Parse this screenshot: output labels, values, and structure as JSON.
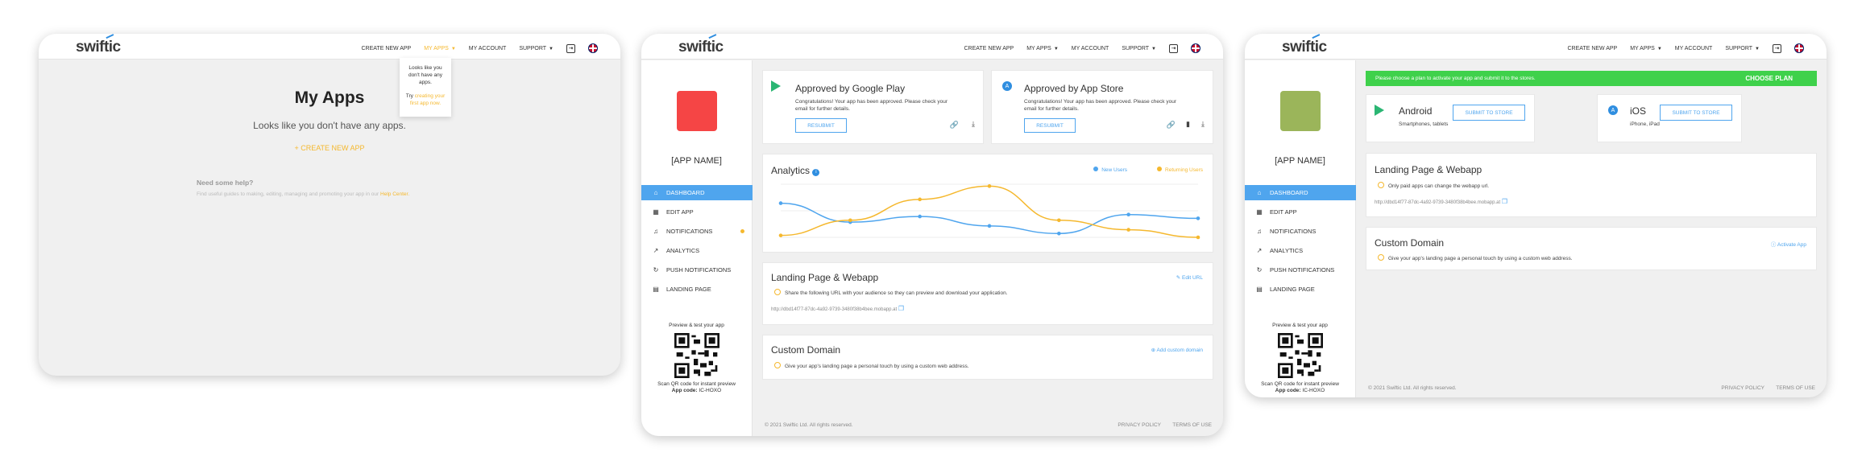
{
  "logo": "swiftic",
  "nav": {
    "create": "CREATE NEW APP",
    "myapps": "MY APPS",
    "account": "MY ACCOUNT",
    "support": "SUPPORT"
  },
  "w1": {
    "dropdown": {
      "l1": "Looks like you",
      "l2": "don't have any",
      "l3": "apps.",
      "l4": "Try",
      "l5": "creating your",
      "l6": "first app now."
    },
    "title": "My Apps",
    "subtitle": "Looks like you don't have any apps.",
    "create_link": "CREATE NEW APP",
    "help_title": "Need some help?",
    "help_text": "Find useful guides to making, editing, managing and promoting your app in our",
    "help_link": "Help Center."
  },
  "side": {
    "app_name": "[APP NAME]",
    "menu": [
      {
        "label": "DASHBOARD",
        "icon": "⌂"
      },
      {
        "label": "EDIT APP",
        "icon": "▦"
      },
      {
        "label": "NOTIFICATIONS",
        "icon": "♫"
      },
      {
        "label": "ANALYTICS",
        "icon": "↗"
      },
      {
        "label": "PUSH NOTIFICATIONS",
        "icon": "↻"
      },
      {
        "label": "LANDING PAGE",
        "icon": "▤"
      }
    ],
    "preview": "Preview & test your app",
    "scan": "Scan QR code for instant preview",
    "code_label": "App code:",
    "code": "IC-HOXO"
  },
  "w2": {
    "google": {
      "title": "Approved by Google Play",
      "l1": "Congratulations! Your app has been approved. Please check your",
      "l2": "email for further details.",
      "btn": "RESUBMIT"
    },
    "apple": {
      "title": "Approved by App Store",
      "l1": "Congratulations! Your app has been approved. Please check your",
      "l2": "email for further details.",
      "btn": "RESUBMIT"
    },
    "analytics": {
      "title": "Analytics",
      "new": "New Users",
      "ret": "Returning Users"
    },
    "landing": {
      "title": "Landing Page & Webapp",
      "edit": "Edit URL",
      "text": "Share the following URL with your audience so they can preview and download your application.",
      "url": "http://dbd14f77-87dc-4a92-9739-3480f38b4bee.mobapp.at"
    },
    "domain": {
      "title": "Custom Domain",
      "add": "Add custom domain",
      "text": "Give your app's landing page a personal touch by using a custom web address."
    }
  },
  "w3": {
    "banner": "Please choose a plan to activate your app and submit it to the stores.",
    "plan": "CHOOSE PLAN",
    "android": {
      "title": "Android",
      "sub": "Smartphones, tablets",
      "btn": "SUBMIT TO STORE"
    },
    "ios": {
      "title": "iOS",
      "sub": "iPhone, iPad",
      "btn": "SUBMIT TO STORE"
    },
    "landing": {
      "title": "Landing Page & Webapp",
      "text": "Only paid apps can change the webapp url.",
      "url": "http://dbd14f77-87dc-4a92-9739-3480f38b4bee.mobapp.at"
    },
    "domain": {
      "title": "Custom Domain",
      "activate": "Activate App",
      "text": "Give your app's landing page a personal touch by using a custom web address."
    }
  },
  "footer": {
    "copy": "© 2021 Swiftic Ltd. All rights reserved.",
    "privacy": "PRIVACY POLICY",
    "terms": "TERMS OF USE"
  },
  "colors": {
    "accent": "#4fa5ee",
    "yellow": "#f5b82e",
    "red_app": "#f54545",
    "green_app": "#9bb55a",
    "banner": "#3fd14b"
  },
  "chart_data": {
    "type": "line",
    "series": [
      {
        "name": "New Users",
        "color": "#4fa5ee",
        "values": [
          90,
          40,
          55,
          30,
          10,
          60,
          50
        ]
      },
      {
        "name": "Returning Users",
        "color": "#f5b82e",
        "values": [
          5,
          45,
          100,
          135,
          45,
          20,
          0
        ]
      }
    ]
  }
}
